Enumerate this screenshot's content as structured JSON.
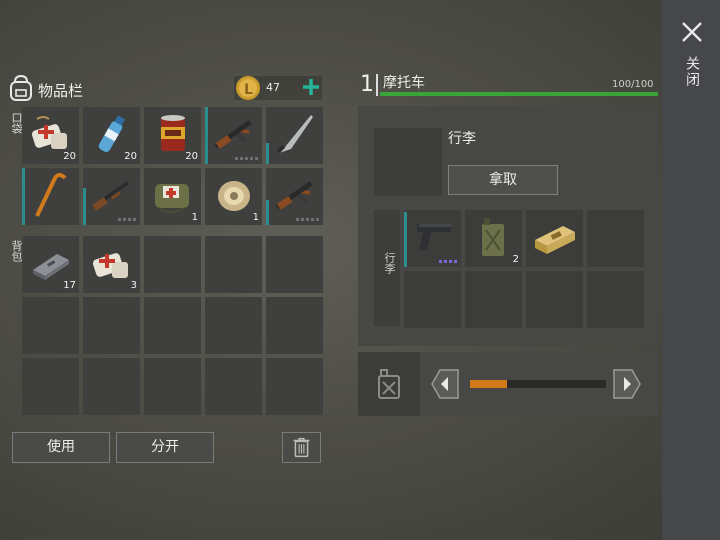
{
  "inventory": {
    "title": "物品栏",
    "coins": "47",
    "pockets_label": "口袋",
    "backpack_label": "背包",
    "pockets": [
      {
        "icon": "medkit-icon",
        "count": "20"
      },
      {
        "icon": "water-bottle-icon",
        "count": "20"
      },
      {
        "icon": "canned-food-icon",
        "count": "20"
      },
      {
        "icon": "rifle-icon",
        "count": ""
      },
      {
        "icon": "machete-icon",
        "count": ""
      },
      {
        "icon": "crowbar-icon",
        "count": ""
      },
      {
        "icon": "shotgun-icon",
        "count": ""
      },
      {
        "icon": "first-aid-bag-icon",
        "count": "1"
      },
      {
        "icon": "rope-spool-icon",
        "count": "1"
      },
      {
        "icon": "rifle-icon",
        "count": ""
      }
    ],
    "backpack": [
      {
        "icon": "metal-plate-icon",
        "count": "17"
      },
      {
        "icon": "medkit-icon",
        "count": "3"
      }
    ],
    "use_button": "使用",
    "split_button": "分开"
  },
  "vehicle": {
    "slot_number": "1",
    "name": "摩托车",
    "durability": "100/100",
    "durability_fraction": 1.0,
    "trunk_title": "行李",
    "take_button": "拿取",
    "trunk_side_label": "行李",
    "trunk_items": [
      {
        "icon": "pistol-icon",
        "count": ""
      },
      {
        "icon": "jerrycan-icon",
        "count": "2"
      },
      {
        "icon": "ammo-box-icon",
        "count": ""
      }
    ],
    "fuel_fraction": 0.27
  },
  "close_label": "关闭",
  "colors": {
    "durability_bar": "#3aa33a",
    "fuel_bar": "#d07a1c",
    "slot_accent": "#2d8c8e",
    "plus_icon": "#27b59a"
  }
}
